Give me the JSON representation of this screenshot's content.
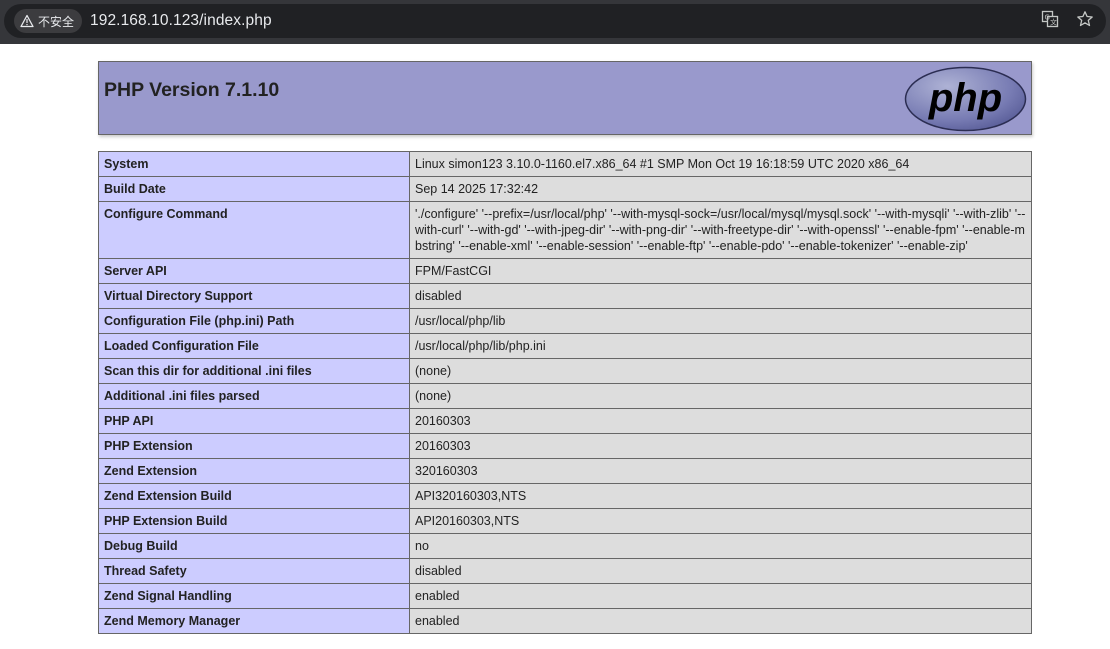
{
  "browser": {
    "security_label": "不安全",
    "url": "192.168.10.123/index.php",
    "icons": [
      "warning-triangle-icon",
      "translate-icon",
      "bookmark-star-icon"
    ]
  },
  "header": {
    "title": "PHP Version 7.1.10",
    "logo_text": "php"
  },
  "rows": [
    {
      "key": "System",
      "value": "Linux simon123 3.10.0-1160.el7.x86_64 #1 SMP Mon Oct 19 16:18:59 UTC 2020 x86_64"
    },
    {
      "key": "Build Date",
      "value": "Sep 14 2025 17:32:42"
    },
    {
      "key": "Configure Command",
      "value": "'./configure' '--prefix=/usr/local/php' '--with-mysql-sock=/usr/local/mysql/mysql.sock' '--with-mysqli' '--with-zlib' '--with-curl' '--with-gd' '--with-jpeg-dir' '--with-png-dir' '--with-freetype-dir' '--with-openssl' '--enable-fpm' '--enable-mbstring' '--enable-xml' '--enable-session' '--enable-ftp' '--enable-pdo' '--enable-tokenizer' '--enable-zip'"
    },
    {
      "key": "Server API",
      "value": "FPM/FastCGI"
    },
    {
      "key": "Virtual Directory Support",
      "value": "disabled"
    },
    {
      "key": "Configuration File (php.ini) Path",
      "value": "/usr/local/php/lib"
    },
    {
      "key": "Loaded Configuration File",
      "value": "/usr/local/php/lib/php.ini"
    },
    {
      "key": "Scan this dir for additional .ini files",
      "value": "(none)"
    },
    {
      "key": "Additional .ini files parsed",
      "value": "(none)"
    },
    {
      "key": "PHP API",
      "value": "20160303"
    },
    {
      "key": "PHP Extension",
      "value": "20160303"
    },
    {
      "key": "Zend Extension",
      "value": "320160303"
    },
    {
      "key": "Zend Extension Build",
      "value": "API320160303,NTS"
    },
    {
      "key": "PHP Extension Build",
      "value": "API20160303,NTS"
    },
    {
      "key": "Debug Build",
      "value": "no"
    },
    {
      "key": "Thread Safety",
      "value": "disabled"
    },
    {
      "key": "Zend Signal Handling",
      "value": "enabled"
    },
    {
      "key": "Zend Memory Manager",
      "value": "enabled"
    }
  ]
}
